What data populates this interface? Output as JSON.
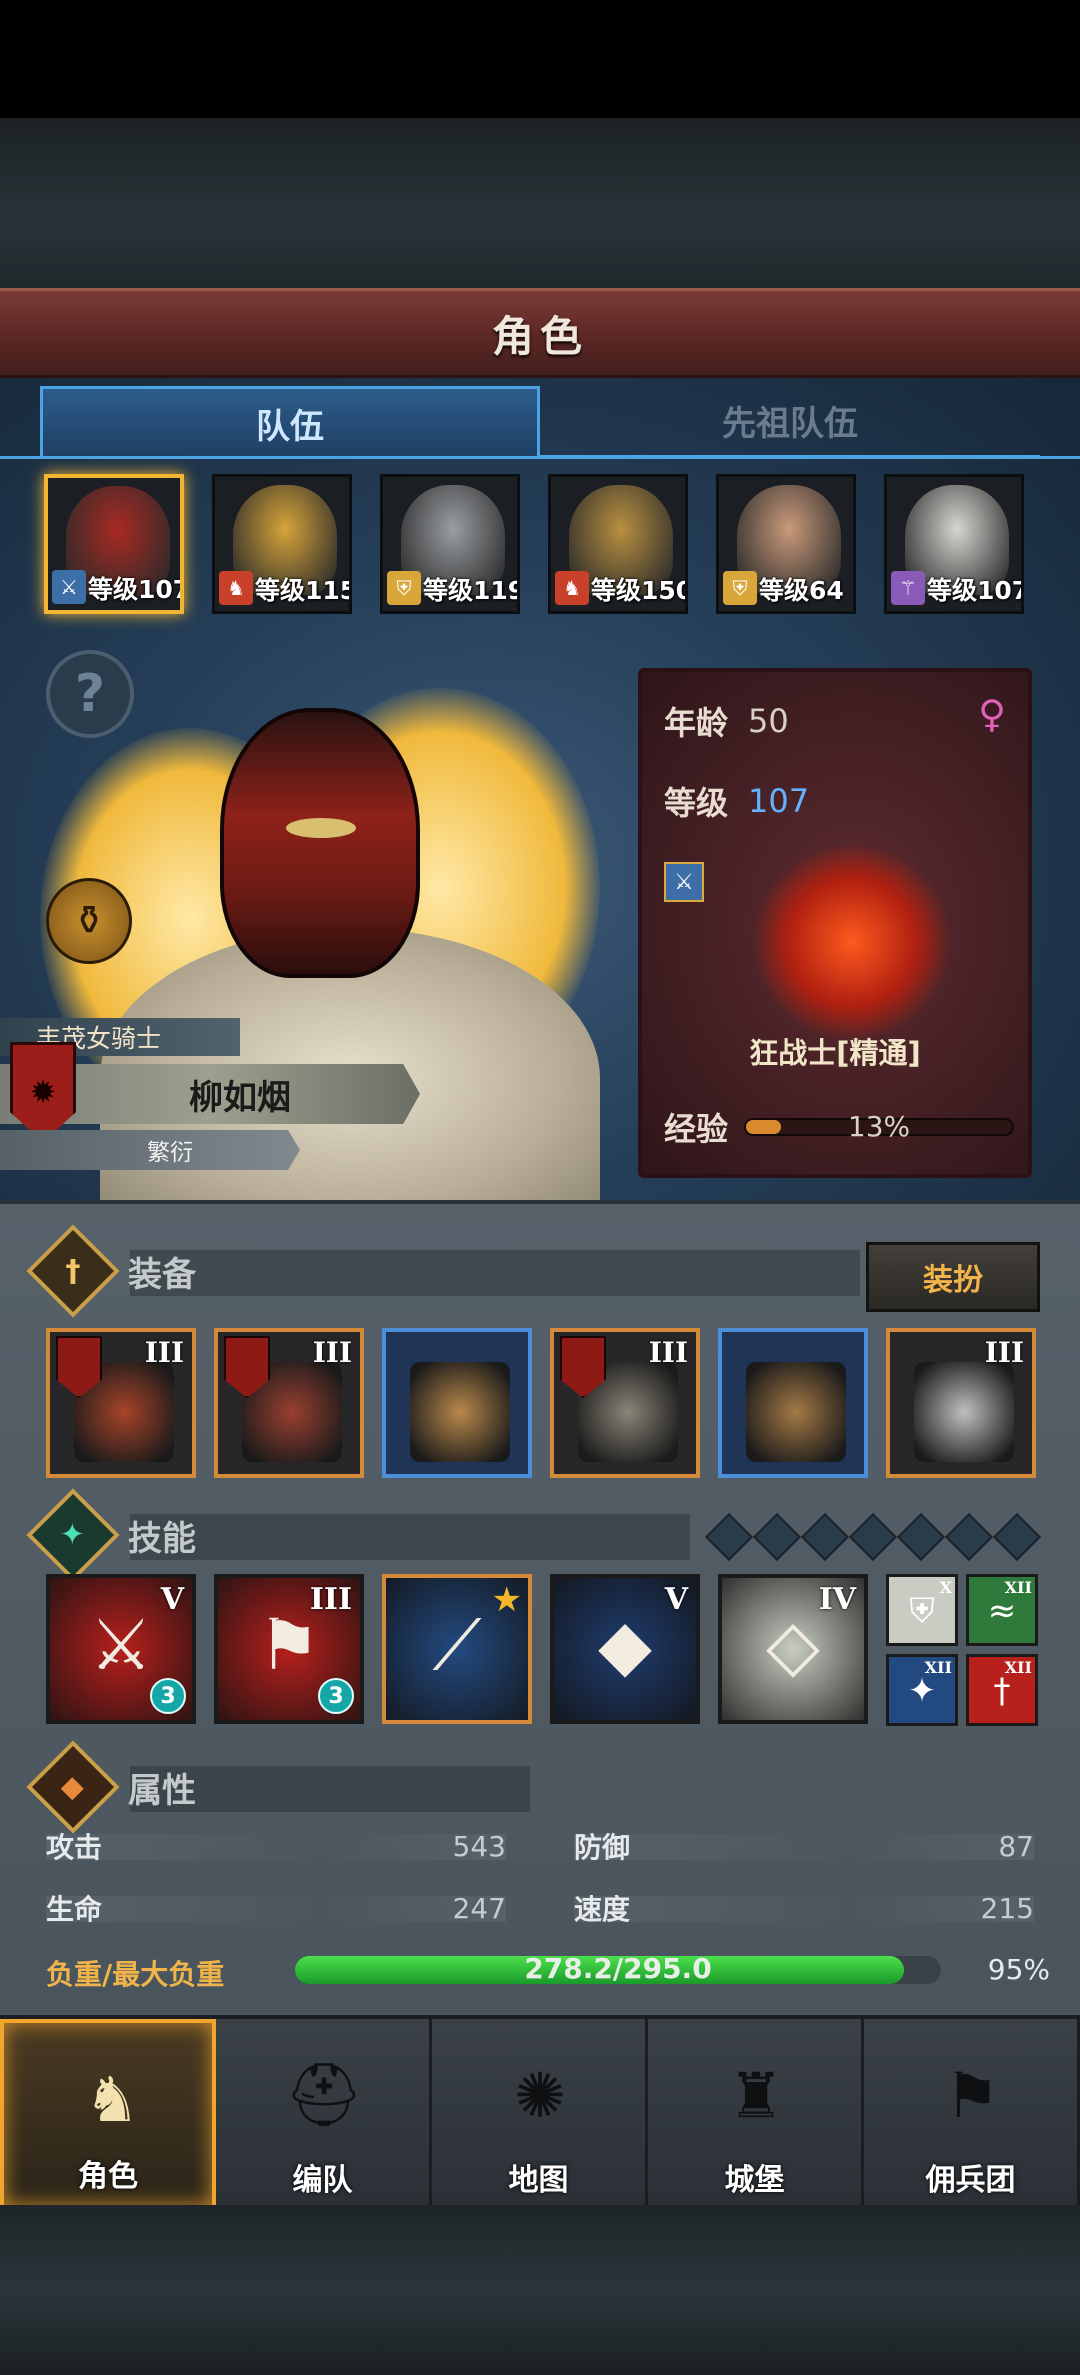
{
  "title": "角色",
  "tabs": [
    {
      "label": "队伍",
      "active": true
    },
    {
      "label": "先祖队伍",
      "active": false
    }
  ],
  "party": [
    {
      "level_text": "等级107",
      "class_icon": "sword-icon",
      "class_color": "#3d6ea8",
      "skin": "#a82a22",
      "selected": true
    },
    {
      "level_text": "等级115",
      "class_icon": "horse-icon",
      "class_color": "#c8402a",
      "skin": "#d6a43a",
      "selected": false
    },
    {
      "level_text": "等级119",
      "class_icon": "shield-icon",
      "class_color": "#d9a63a",
      "skin": "#9a9ea2",
      "selected": false
    },
    {
      "level_text": "等级150",
      "class_icon": "horse-icon",
      "class_color": "#c8402a",
      "skin": "#b89040",
      "selected": false
    },
    {
      "level_text": "等级64",
      "class_icon": "shield-icon",
      "class_color": "#d9a63a",
      "skin": "#c99a7a",
      "selected": false
    },
    {
      "level_text": "等级107",
      "class_icon": "staff-icon",
      "class_color": "#8a5ab8",
      "skin": "#d8d6d2",
      "selected": false
    }
  ],
  "hero": {
    "title": "丰茂女骑士",
    "name": "柳如烟",
    "status": "繁衍"
  },
  "info": {
    "age_label": "年龄",
    "age": "50",
    "level_label": "等级",
    "level": "107",
    "gender_symbol": "♀",
    "class_name": "狂战士[精通]",
    "exp_label": "经验",
    "exp_text": "13%",
    "exp_fraction": 0.13
  },
  "equipment": {
    "label": "装备",
    "dress_button": "装扮",
    "slots": [
      {
        "tier": "III",
        "banner": true,
        "color": "orange",
        "art": "#a8442a"
      },
      {
        "tier": "III",
        "banner": true,
        "color": "orange",
        "art": "#9a4030"
      },
      {
        "tier": "",
        "banner": false,
        "color": "blue",
        "art": "#b8884a"
      },
      {
        "tier": "III",
        "banner": true,
        "color": "orange",
        "art": "#8a8478"
      },
      {
        "tier": "",
        "banner": false,
        "color": "blue",
        "art": "#a47a46"
      },
      {
        "tier": "III",
        "banner": false,
        "color": "orange",
        "art": "#c0c0c0"
      }
    ]
  },
  "skills": {
    "label": "技能",
    "pip_count": 7,
    "items": [
      {
        "tier": "V",
        "bg": "#b8201c",
        "glyph": "⚔",
        "count": "3",
        "star": false,
        "border": "#1a1a1a"
      },
      {
        "tier": "III",
        "bg": "#b8201c",
        "glyph": "⚑",
        "count": "3",
        "star": false,
        "border": "#1a1a1a"
      },
      {
        "tier": "",
        "bg": "#234a80",
        "glyph": "⟋",
        "count": "",
        "star": true,
        "border": "#d58a3a"
      },
      {
        "tier": "V",
        "bg": "#1f3c6e",
        "glyph": "◆",
        "count": "",
        "star": false,
        "border": "#1a1a1a"
      },
      {
        "tier": "IV",
        "bg": "#c9cdc2",
        "glyph": "◇",
        "count": "",
        "star": false,
        "border": "#1a1a1a"
      }
    ],
    "minis": [
      {
        "tier": "X",
        "bg": "#c8ccc2",
        "glyph": "⛨"
      },
      {
        "tier": "XII",
        "bg": "#2f7a3a",
        "glyph": "≈"
      },
      {
        "tier": "XII",
        "bg": "#234a80",
        "glyph": "✦"
      },
      {
        "tier": "XII",
        "bg": "#b8201c",
        "glyph": "†"
      }
    ]
  },
  "attributes": {
    "label": "属性",
    "stats": [
      {
        "label": "攻击",
        "value": "543"
      },
      {
        "label": "防御",
        "value": "87"
      },
      {
        "label": "生命",
        "value": "247"
      },
      {
        "label": "速度",
        "value": "215"
      }
    ],
    "load_label": "负重/最大负重",
    "load_text": "278.2/295.0",
    "load_fraction": 0.943,
    "load_pct": "95%"
  },
  "nav": [
    {
      "label": "角色",
      "icon": "knight-icon",
      "active": true
    },
    {
      "label": "编队",
      "icon": "helmet-icon",
      "active": false
    },
    {
      "label": "地图",
      "icon": "compass-icon",
      "active": false
    },
    {
      "label": "城堡",
      "icon": "castle-icon",
      "active": false
    },
    {
      "label": "佣兵团",
      "icon": "banner-icon",
      "active": false
    }
  ],
  "icons": {
    "help": "?",
    "potion": "⚱",
    "equip_section": "†",
    "skill_section": "✦",
    "attr_section": "◆",
    "nav_glyphs": [
      "♞",
      "⛑",
      "✺",
      "♜",
      "⚑"
    ]
  }
}
